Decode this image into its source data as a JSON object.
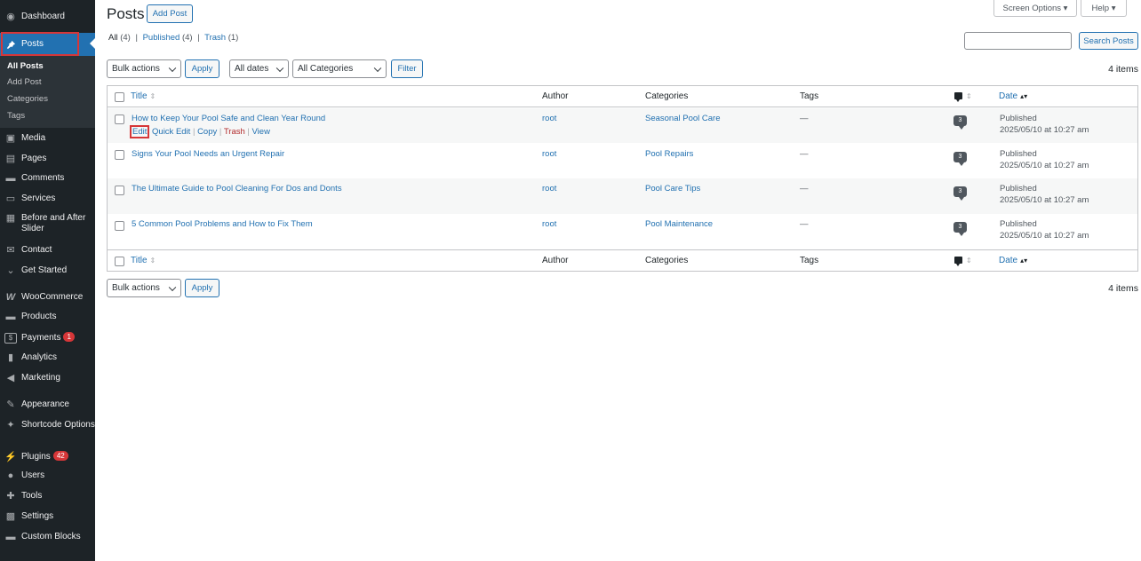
{
  "sidebar": {
    "items": [
      {
        "label": "Dashboard",
        "icon": "dashboard-icon",
        "glyph": "◉"
      },
      {
        "label": "Posts",
        "icon": "pin-icon",
        "glyph": "📌"
      },
      {
        "label": "Media",
        "icon": "media-icon",
        "glyph": "▣"
      },
      {
        "label": "Pages",
        "icon": "pages-icon",
        "glyph": "▤"
      },
      {
        "label": "Comments",
        "icon": "comments-icon",
        "glyph": "▬"
      },
      {
        "label": "Services",
        "icon": "folder-icon",
        "glyph": "▭"
      },
      {
        "label": "Before and After Slider",
        "icon": "slider-icon",
        "glyph": "▦"
      },
      {
        "label": "Contact",
        "icon": "mail-icon",
        "glyph": "✉"
      },
      {
        "label": "Get Started",
        "icon": "chevron-icon",
        "glyph": "⌄"
      },
      {
        "label": "WooCommerce",
        "icon": "woocommerce-icon",
        "glyph": "W"
      },
      {
        "label": "Products",
        "icon": "products-icon",
        "glyph": "▬"
      },
      {
        "label": "Payments",
        "icon": "dollar-icon",
        "glyph": "$",
        "badge": "1"
      },
      {
        "label": "Analytics",
        "icon": "bar-chart-icon",
        "glyph": "▮"
      },
      {
        "label": "Marketing",
        "icon": "megaphone-icon",
        "glyph": "◀"
      },
      {
        "label": "Appearance",
        "icon": "brush-icon",
        "glyph": "✎"
      },
      {
        "label": "Shortcode Options",
        "icon": "pin-icon",
        "glyph": "✦"
      },
      {
        "label": "Plugins",
        "icon": "plug-icon",
        "glyph": "⚡",
        "badge": "42"
      },
      {
        "label": "Users",
        "icon": "user-icon",
        "glyph": "●"
      },
      {
        "label": "Tools",
        "icon": "wrench-icon",
        "glyph": "✚"
      },
      {
        "label": "Settings",
        "icon": "settings-icon",
        "glyph": "▩"
      },
      {
        "label": "Custom Blocks",
        "icon": "blocks-icon",
        "glyph": "▬"
      }
    ],
    "submenu": [
      "All Posts",
      "Add Post",
      "Categories",
      "Tags"
    ]
  },
  "header": {
    "title": "Posts",
    "add_post": "Add Post",
    "screen_options": "Screen Options ▾",
    "help": "Help ▾"
  },
  "filters_links": {
    "all": "All",
    "all_count": "(4)",
    "published": "Published",
    "published_count": "(4)",
    "trash": "Trash",
    "trash_count": "(1)",
    "sep": "|"
  },
  "search": {
    "button": "Search Posts",
    "value": ""
  },
  "toolbar": {
    "bulk_actions": "Bulk actions",
    "apply": "Apply",
    "dates": "All dates",
    "categories": "All Categories",
    "filter": "Filter",
    "items_count": "4 items"
  },
  "table": {
    "columns": {
      "title": "Title",
      "author": "Author",
      "categories": "Categories",
      "tags": "Tags",
      "date": "Date"
    },
    "rows": [
      {
        "title": "How to Keep Your Pool Safe and Clean Year Round",
        "author": "root",
        "category": "Seasonal Pool Care",
        "tags": "—",
        "comments": "3",
        "status": "Published",
        "date": "2025/05/10 at 10:27 am"
      },
      {
        "title": "Signs Your Pool Needs an Urgent Repair",
        "author": "root",
        "category": "Pool Repairs",
        "tags": "—",
        "comments": "3",
        "status": "Published",
        "date": "2025/05/10 at 10:27 am"
      },
      {
        "title": "The Ultimate Guide to Pool Cleaning For Dos and Donts",
        "author": "root",
        "category": "Pool Care Tips",
        "tags": "—",
        "comments": "3",
        "status": "Published",
        "date": "2025/05/10 at 10:27 am"
      },
      {
        "title": "5 Common Pool Problems and How to Fix Them",
        "author": "root",
        "category": "Pool Maintenance",
        "tags": "—",
        "comments": "3",
        "status": "Published",
        "date": "2025/05/10 at 10:27 am"
      }
    ],
    "row_actions": {
      "edit": "Edit",
      "quick_edit": "Quick Edit",
      "copy": "Copy",
      "trash": "Trash",
      "view": "View",
      "sep": "|"
    }
  }
}
